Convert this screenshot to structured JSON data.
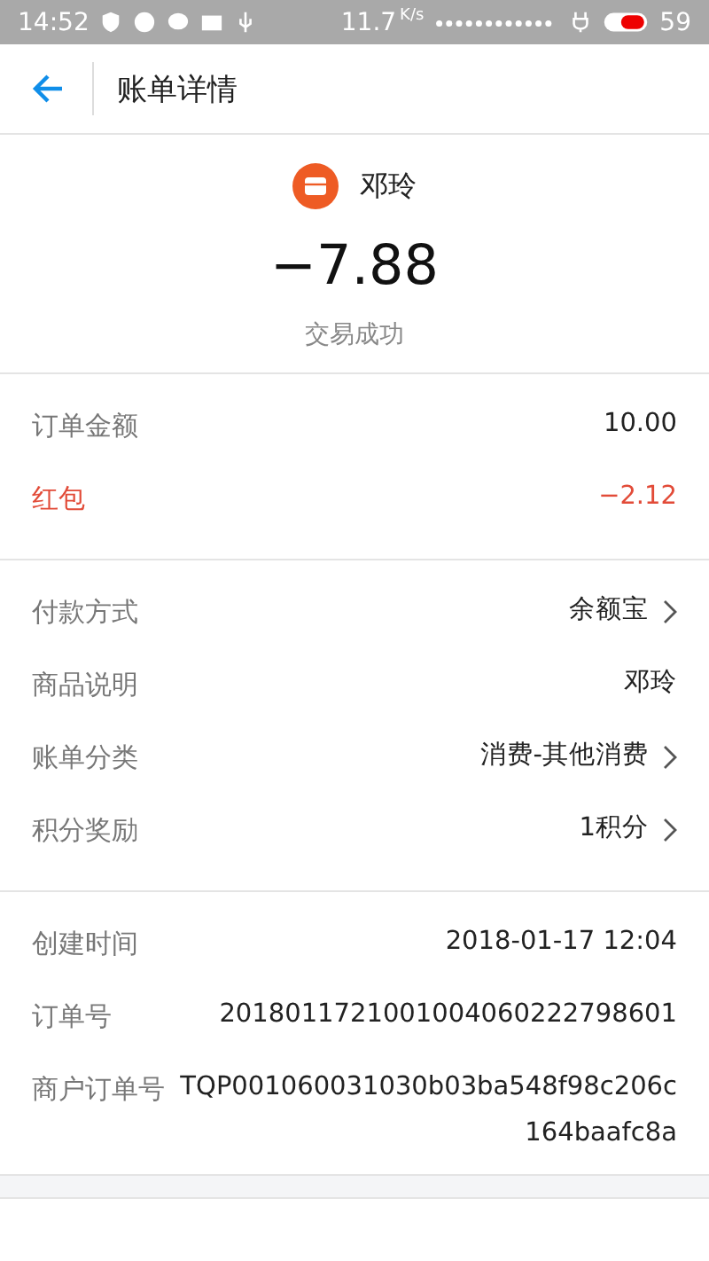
{
  "status_bar": {
    "time": "14:52",
    "speed": "11.7",
    "speed_unit": "K/s",
    "battery": "59"
  },
  "header": {
    "title": "账单详情"
  },
  "summary": {
    "merchant": "邓玲",
    "amount": "−7.88",
    "status": "交易成功"
  },
  "sections": [
    {
      "rows": [
        {
          "label": "订单金额",
          "value": "10.00",
          "kind": "plain",
          "link": false
        },
        {
          "label": "红包",
          "value": "−2.12",
          "kind": "discount",
          "link": false
        }
      ]
    },
    {
      "rows": [
        {
          "label": "付款方式",
          "value": "余额宝",
          "kind": "plain",
          "link": true
        },
        {
          "label": "商品说明",
          "value": "邓玲",
          "kind": "plain",
          "link": false
        },
        {
          "label": "账单分类",
          "value": "消费-其他消费",
          "kind": "plain",
          "link": true
        },
        {
          "label": "积分奖励",
          "value": "1积分",
          "kind": "plain",
          "link": true
        }
      ]
    },
    {
      "rows": [
        {
          "label": "创建时间",
          "value": "2018-01-17  12:04",
          "kind": "plain",
          "link": false
        },
        {
          "label": "订单号",
          "value": "20180117210010040602227986​01",
          "kind": "plain",
          "link": false
        },
        {
          "label": "商户订单号",
          "value": "TQP001060031030b03ba548f98c206c164baafc8a",
          "kind": "plain",
          "link": false
        }
      ]
    }
  ]
}
